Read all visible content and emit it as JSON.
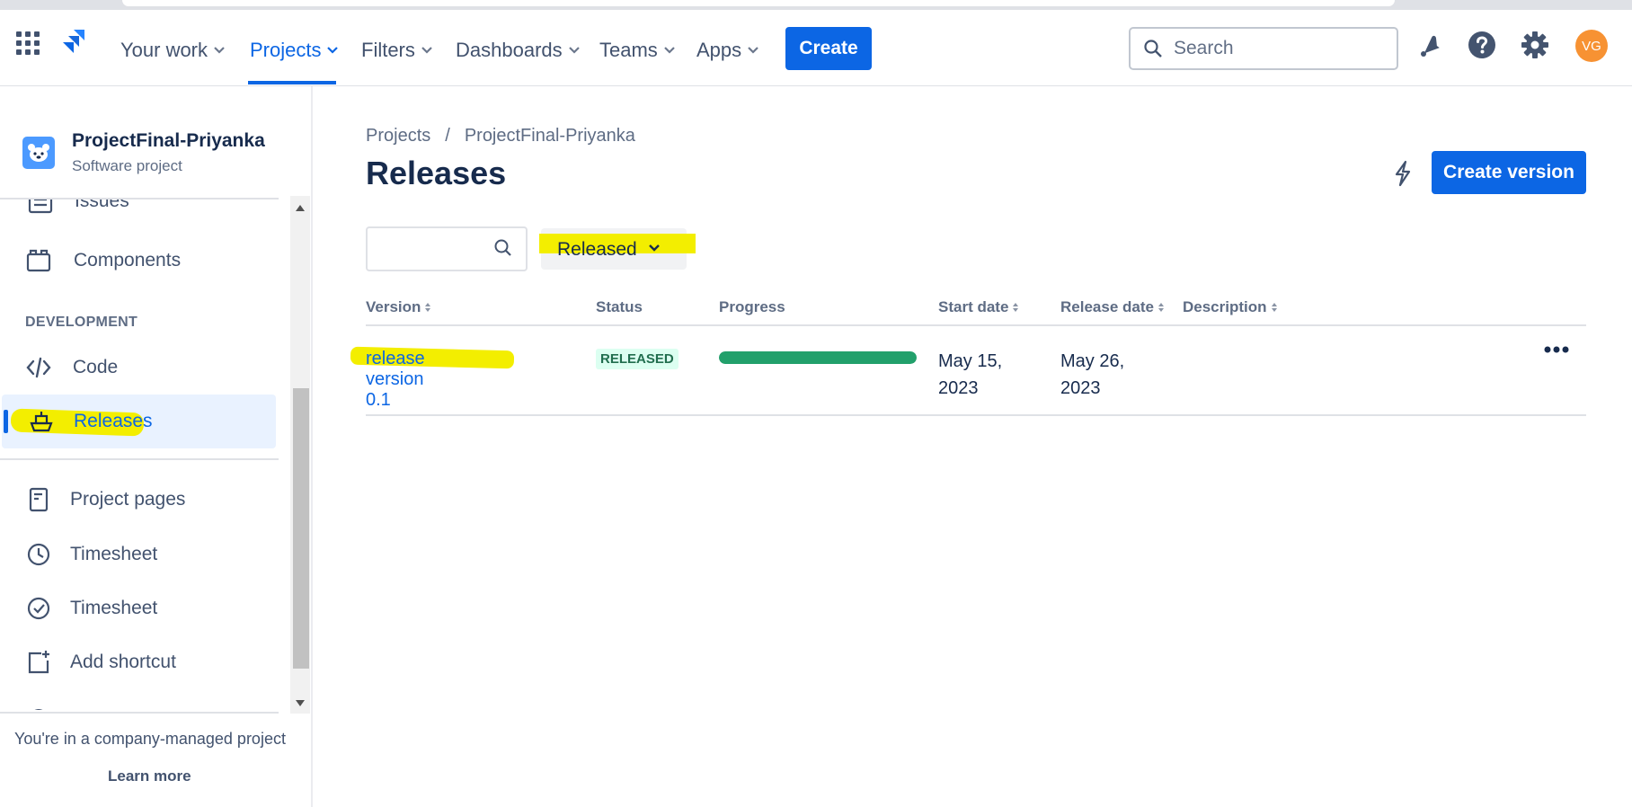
{
  "nav": {
    "your_work": "Your work",
    "projects": "Projects",
    "filters": "Filters",
    "dashboards": "Dashboards",
    "teams": "Teams",
    "apps": "Apps",
    "create": "Create",
    "search_placeholder": "Search",
    "avatar_initials": "VG"
  },
  "sidebar": {
    "project_name": "ProjectFinal-Priyanka",
    "project_type": "Software project",
    "items": {
      "issues": "Issues",
      "components": "Components",
      "development_heading": "DEVELOPMENT",
      "code": "Code",
      "releases": "Releases",
      "project_pages": "Project pages",
      "timesheet_1": "Timesheet",
      "timesheet_2": "Timesheet",
      "add_shortcut": "Add shortcut"
    },
    "footer_note": "You're in a company-managed project",
    "learn_more": "Learn more"
  },
  "main": {
    "breadcrumb": [
      "Projects",
      "/",
      "ProjectFinal-Priyanka"
    ],
    "title": "Releases",
    "create_version": "Create version",
    "filter_status": "Released",
    "columns": {
      "version": "Version",
      "status": "Status",
      "progress": "Progress",
      "start_date": "Start date",
      "release_date": "Release date",
      "description": "Description"
    },
    "rows": [
      {
        "version": "release version 0.1",
        "status": "RELEASED",
        "progress_percent": 100,
        "start_date": "May 15, 2023",
        "release_date": "May 26, 2023",
        "description": ""
      }
    ]
  },
  "colors": {
    "accent": "#0c66e4",
    "highlight": "#f3ee00",
    "progress": "#22a06b",
    "avatar": "#f79233"
  }
}
